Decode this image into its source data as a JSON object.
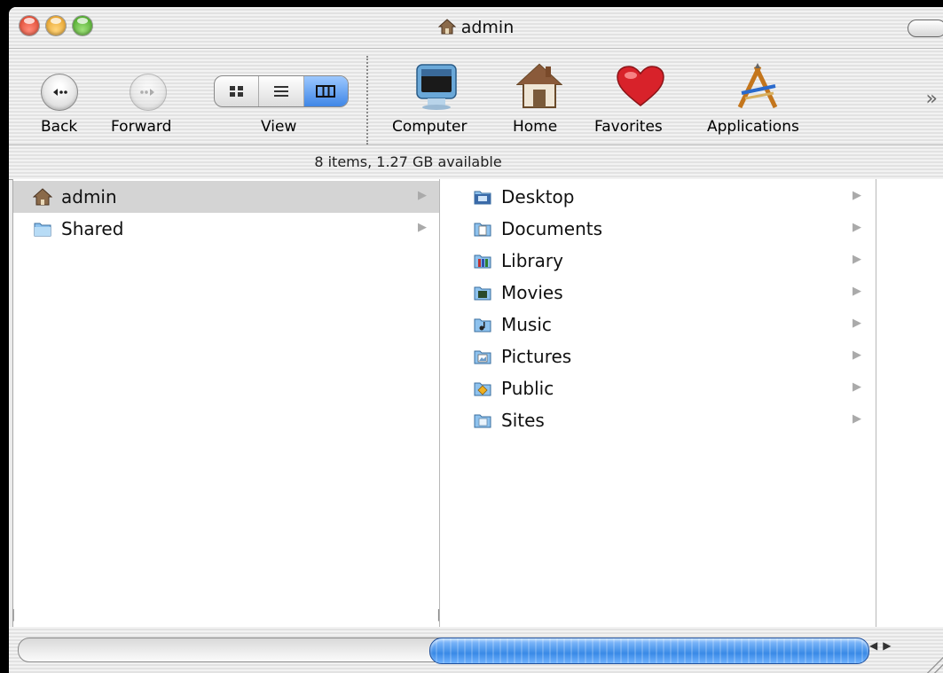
{
  "window": {
    "title": "admin"
  },
  "toolbar": {
    "back_label": "Back",
    "forward_label": "Forward",
    "view_label": "View",
    "shortcuts": [
      {
        "label": "Computer",
        "icon": "computer-icon"
      },
      {
        "label": "Home",
        "icon": "home-icon"
      },
      {
        "label": "Favorites",
        "icon": "heart-icon"
      },
      {
        "label": "Applications",
        "icon": "applications-icon"
      }
    ],
    "overflow_icon": "chevron-right-double-icon"
  },
  "status": {
    "text": "8 items, 1.27 GB available"
  },
  "columns": {
    "col1": [
      {
        "label": "admin",
        "icon": "home-icon",
        "selected": true
      },
      {
        "label": "Shared",
        "icon": "folder-icon",
        "selected": false
      }
    ],
    "col2": [
      {
        "label": "Desktop",
        "icon": "desktop-folder-icon"
      },
      {
        "label": "Documents",
        "icon": "documents-folder-icon"
      },
      {
        "label": "Library",
        "icon": "library-folder-icon"
      },
      {
        "label": "Movies",
        "icon": "movies-folder-icon"
      },
      {
        "label": "Music",
        "icon": "music-folder-icon"
      },
      {
        "label": "Pictures",
        "icon": "pictures-folder-icon"
      },
      {
        "label": "Public",
        "icon": "public-folder-icon"
      },
      {
        "label": "Sites",
        "icon": "sites-folder-icon"
      }
    ]
  },
  "colors": {
    "selection": "#d4d4d4",
    "scroll_thumb": "#3a8ae6"
  }
}
